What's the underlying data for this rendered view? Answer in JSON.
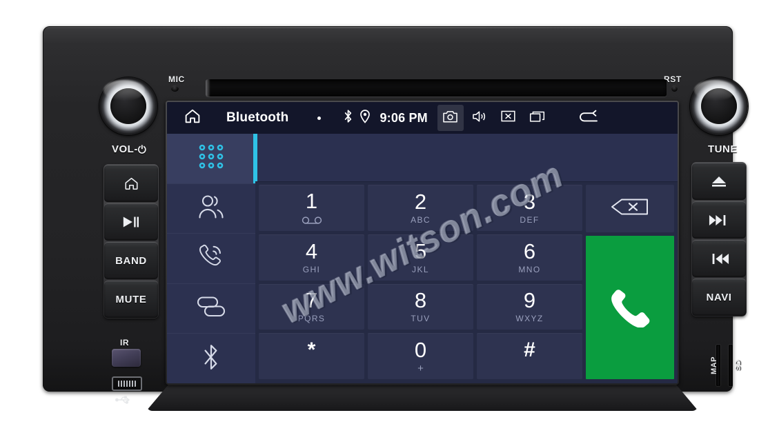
{
  "device": {
    "name": "car-stereo-head-unit",
    "mic_label": "MIC",
    "rst_label": "RST",
    "vol_label": "VOL-",
    "tune_label": "TUNE",
    "ir_label": "IR",
    "map_slot_label": "MAP",
    "sd_slot_label": "SD",
    "left_buttons": [
      {
        "name": "home",
        "label": "",
        "icon": "home-icon"
      },
      {
        "name": "play-pause",
        "label": "",
        "icon": "play-pause-icon"
      },
      {
        "name": "band",
        "label": "BAND",
        "icon": ""
      },
      {
        "name": "mute",
        "label": "MUTE",
        "icon": ""
      }
    ],
    "right_buttons": [
      {
        "name": "eject",
        "label": "",
        "icon": "eject-icon"
      },
      {
        "name": "next-track",
        "label": "",
        "icon": "next-track-icon"
      },
      {
        "name": "previous-track",
        "label": "",
        "icon": "previous-track-icon"
      },
      {
        "name": "navi",
        "label": "NAVI",
        "icon": ""
      }
    ]
  },
  "statusbar": {
    "home_icon": "home-icon",
    "title": "Bluetooth",
    "dot": "•",
    "bluetooth_icon": "bluetooth-icon",
    "location_icon": "location-pin-icon",
    "clock": "9:06 PM",
    "screenshot_icon": "camera-icon",
    "volume_icon": "speaker-icon",
    "close_icon": "close-box-icon",
    "recents_icon": "recent-apps-icon",
    "back_icon": "back-arrow-icon"
  },
  "sidebar": {
    "items": [
      {
        "name": "dialpad",
        "icon": "dialpad-icon",
        "active": true
      },
      {
        "name": "contacts",
        "icon": "contacts-person-icon",
        "active": false
      },
      {
        "name": "call-history",
        "icon": "phone-signal-icon",
        "active": false
      },
      {
        "name": "sync-link",
        "icon": "link-chain-icon",
        "active": false
      },
      {
        "name": "bluetooth",
        "icon": "bluetooth-icon",
        "active": false
      }
    ]
  },
  "dialer": {
    "number_input": "",
    "number_placeholder": "",
    "keys": [
      {
        "digit": "1",
        "sub": "",
        "sub_icon": "voicemail-icon"
      },
      {
        "digit": "2",
        "sub": "ABC",
        "sub_icon": ""
      },
      {
        "digit": "3",
        "sub": "DEF",
        "sub_icon": ""
      },
      {
        "digit": "4",
        "sub": "GHI",
        "sub_icon": ""
      },
      {
        "digit": "5",
        "sub": "JKL",
        "sub_icon": ""
      },
      {
        "digit": "6",
        "sub": "MNO",
        "sub_icon": ""
      },
      {
        "digit": "7",
        "sub": "PQRS",
        "sub_icon": ""
      },
      {
        "digit": "8",
        "sub": "TUV",
        "sub_icon": ""
      },
      {
        "digit": "9",
        "sub": "WXYZ",
        "sub_icon": ""
      },
      {
        "digit": "*",
        "sub": "",
        "sub_icon": ""
      },
      {
        "digit": "0",
        "sub": "+",
        "sub_icon": ""
      },
      {
        "digit": "#",
        "sub": "",
        "sub_icon": ""
      }
    ],
    "backspace_icon": "backspace-icon",
    "call_icon": "phone-handset-icon",
    "call_button_color": "#0a9d3f"
  },
  "watermark": {
    "text": "www.witson.com"
  },
  "colors": {
    "accent_cyan": "#2fc2e6",
    "screen_bg": "#252a44",
    "statusbar_bg": "#13162a",
    "rail_bg": "#2c3150",
    "key_bg": "#2e3350",
    "call_green": "#0a9d3f"
  }
}
